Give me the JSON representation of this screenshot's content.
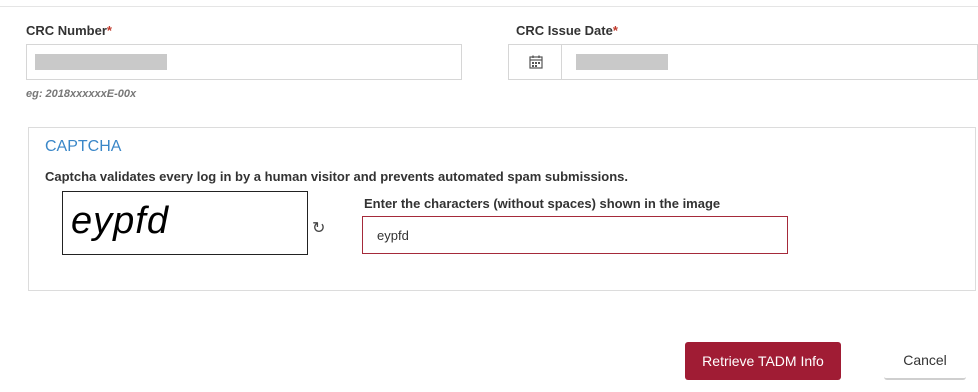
{
  "form": {
    "crc_number": {
      "label": "CRC Number",
      "required_mark": "*",
      "hint": "eg: 2018xxxxxxE-00x"
    },
    "crc_issue_date": {
      "label": "CRC Issue Date",
      "required_mark": "*",
      "icon": "calendar-icon"
    }
  },
  "captcha": {
    "title": "CAPTCHA",
    "description": "Captcha validates every log in by a human visitor and prevents automated spam submissions.",
    "image_text": "eypfd",
    "refresh_icon": "refresh-icon",
    "input_label": "Enter the characters (without spaces) shown in the image",
    "input_value": "eypfd"
  },
  "actions": {
    "retrieve_label": "Retrieve TADM Info",
    "cancel_label": "Cancel"
  },
  "colors": {
    "primary": "#a01c34",
    "accent_title": "#3a87c8",
    "required": "#c0392b"
  }
}
